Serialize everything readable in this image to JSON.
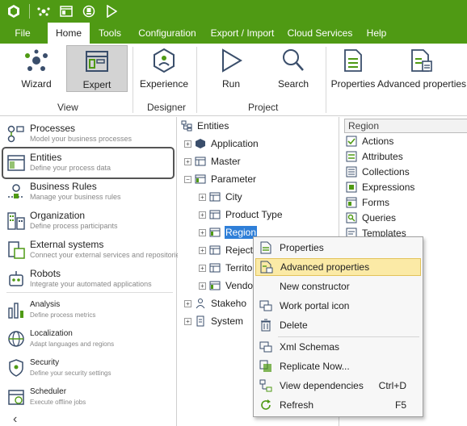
{
  "colors": {
    "brand_green": "#4f9a14",
    "selection_blue": "#2f7fd8",
    "menu_hover": "#fbeaa6"
  },
  "quick_access": {
    "icons": [
      "app-logo-icon",
      "bizagi-eye-icon",
      "window-icon",
      "save-icon",
      "run-icon"
    ]
  },
  "menu": {
    "tabs": [
      {
        "label": "File"
      },
      {
        "label": "Home"
      },
      {
        "label": "Tools"
      },
      {
        "label": "Configuration"
      },
      {
        "label": "Export / Import"
      },
      {
        "label": "Cloud Services"
      },
      {
        "label": "Help"
      }
    ],
    "active": "Home"
  },
  "ribbon": {
    "buttons": {
      "wizard": "Wizard",
      "expert": "Expert",
      "experience": "Experience",
      "run": "Run",
      "search": "Search",
      "properties": "Properties",
      "advanced_properties": "Advanced properties"
    },
    "groups": {
      "view": "View",
      "designer": "Designer",
      "project": "Project"
    }
  },
  "navigator": {
    "items": [
      {
        "title": "Processes",
        "subtitle": "Model your business processes"
      },
      {
        "title": "Entities",
        "subtitle": "Define your process data"
      },
      {
        "title": "Business Rules",
        "subtitle": "Manage your business rules"
      },
      {
        "title": "Organization",
        "subtitle": "Define process participants"
      },
      {
        "title": "External systems",
        "subtitle": "Connect your external services and repositories"
      },
      {
        "title": "Robots",
        "subtitle": "Integrate your automated applications"
      },
      {
        "title": "Analysis",
        "subtitle": "Define process metrics"
      },
      {
        "title": "Localization",
        "subtitle": "Adapt languages and regions"
      },
      {
        "title": "Security",
        "subtitle": "Define your security settings"
      },
      {
        "title": "Scheduler",
        "subtitle": "Execute offline jobs"
      }
    ],
    "collapse_glyph": "‹"
  },
  "tree": {
    "root": "Entities",
    "nodes": {
      "application": "Application",
      "master": "Master",
      "parameter": "Parameter",
      "city": "City",
      "product_type": "Product Type",
      "region": "Region",
      "reject": "Reject",
      "territory": "Territo",
      "vendor": "Vendo",
      "stakeholders": "Stakeho",
      "system": "System"
    }
  },
  "right_panel": {
    "header": "Region",
    "items": [
      "Actions",
      "Attributes",
      "Collections",
      "Expressions",
      "Forms",
      "Queries",
      "Templates"
    ]
  },
  "context_menu": {
    "items": [
      {
        "label": "Properties",
        "shortcut": ""
      },
      {
        "label": "Advanced properties",
        "shortcut": ""
      },
      {
        "label": "New constructor",
        "shortcut": ""
      },
      {
        "label": "Work portal icon",
        "shortcut": ""
      },
      {
        "label": "Delete",
        "shortcut": ""
      },
      {
        "label": "Xml Schemas",
        "shortcut": ""
      },
      {
        "label": "Replicate Now...",
        "shortcut": ""
      },
      {
        "label": "View dependencies",
        "shortcut": "Ctrl+D"
      },
      {
        "label": "Refresh",
        "shortcut": "F5"
      }
    ],
    "hovered": "Advanced properties"
  }
}
